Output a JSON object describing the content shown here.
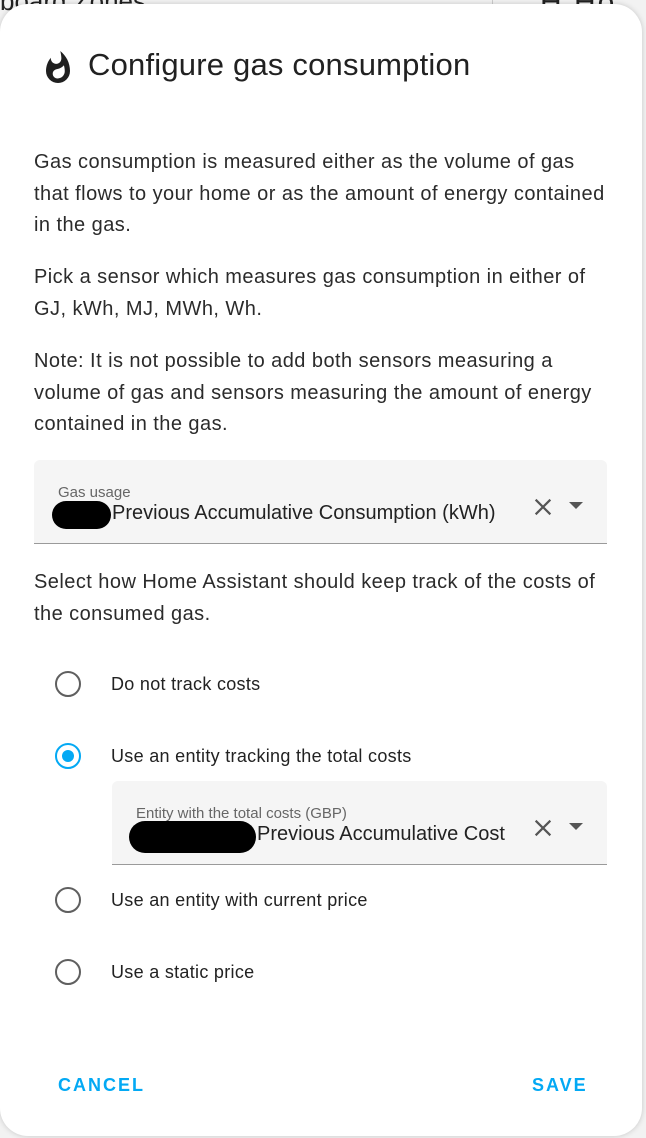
{
  "background": {
    "top_text": "board Zones",
    "top_right": "H Ho"
  },
  "dialog": {
    "title": "Configure gas consumption",
    "description": "Gas consumption is measured either as the volume of gas that flows to your home or as the amount of energy contained in the gas.",
    "unit_hint": "Pick a sensor which measures gas consumption in either of GJ, kWh, MJ, MWh, Wh.",
    "note": "Note: It is not possible to add both sensors measuring a volume of gas and sensors measuring the amount of energy contained in the gas.",
    "gas_usage_field": {
      "label": "Gas usage",
      "value": "Previous Accumulative Consumption (kWh)"
    },
    "cost_prompt": "Select how Home Assistant should keep track of the costs of the consumed gas.",
    "cost_options": [
      {
        "label": "Do not track costs",
        "checked": false
      },
      {
        "label": "Use an entity tracking the total costs",
        "checked": true
      },
      {
        "label": "Use an entity with current price",
        "checked": false
      },
      {
        "label": "Use a static price",
        "checked": false
      }
    ],
    "total_cost_field": {
      "label": "Entity with the total costs (GBP)",
      "value": "Previous Accumulative Cost"
    },
    "buttons": {
      "cancel": "CANCEL",
      "save": "SAVE"
    }
  },
  "colors": {
    "accent": "#03a9f4",
    "text": "#212121",
    "field_bg": "#f5f5f5"
  },
  "icons": {
    "header": "fire-icon",
    "clear": "close-icon",
    "dropdown": "menu-down-icon"
  }
}
